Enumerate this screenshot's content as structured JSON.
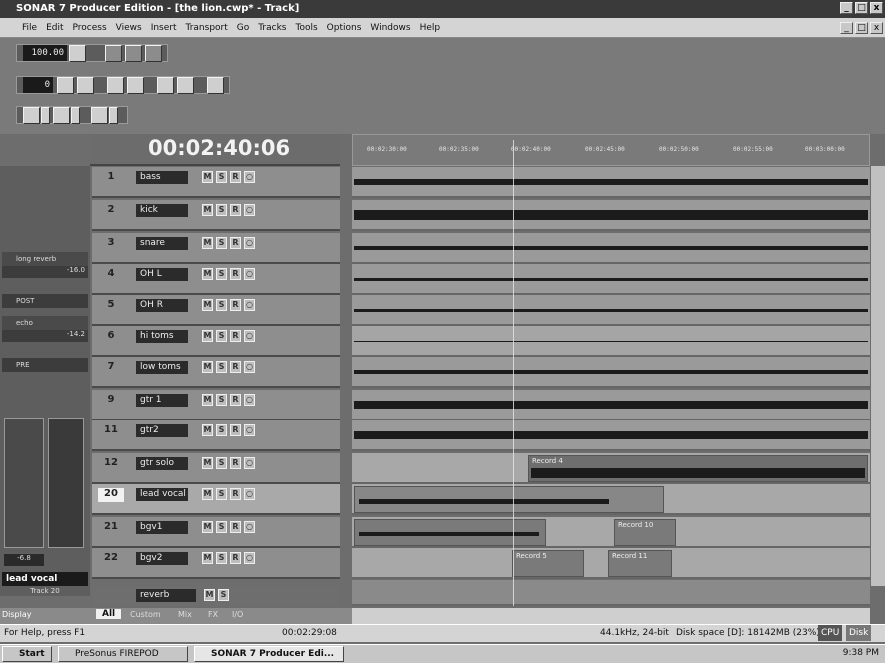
{
  "window": {
    "title": "SONAR 7 Producer Edition - [the lion.cwp* - Track]",
    "controls": [
      "_",
      "□",
      "x"
    ]
  },
  "menu": [
    "File",
    "Edit",
    "Process",
    "Views",
    "Insert",
    "Transport",
    "Go",
    "Tracks",
    "Tools",
    "Options",
    "Windows",
    "Help"
  ],
  "toolbar": {
    "tempo": "100.00",
    "meter_field": "0"
  },
  "transport": {
    "clock": "00:02:40:06"
  },
  "ruler": {
    "ticks": [
      "00:02:30:00",
      "00:02:35:00",
      "00:02:40:00",
      "00:02:45:00",
      "00:02:50:00",
      "00:02:55:00",
      "00:03:00:00"
    ]
  },
  "tracks": [
    {
      "num": "1",
      "name": "bass"
    },
    {
      "num": "2",
      "name": "kick"
    },
    {
      "num": "3",
      "name": "snare"
    },
    {
      "num": "4",
      "name": "OH L"
    },
    {
      "num": "5",
      "name": "OH R"
    },
    {
      "num": "6",
      "name": "hi toms"
    },
    {
      "num": "7",
      "name": "low toms"
    },
    {
      "num": "9",
      "name": "gtr 1"
    },
    {
      "num": "11",
      "name": "gtr2"
    },
    {
      "num": "12",
      "name": "gtr solo"
    },
    {
      "num": "20",
      "name": "lead vocal"
    },
    {
      "num": "21",
      "name": "bgv1"
    },
    {
      "num": "22",
      "name": "bgv2"
    }
  ],
  "clips": {
    "record4": "Record 4",
    "record10": "Record 10",
    "record5": "Record 5",
    "record11": "Record 11"
  },
  "bus": {
    "name": "reverb"
  },
  "inspector": {
    "send1": "long reverb",
    "send1_val": "-16.0",
    "send2": "echo",
    "send2_val": "-14.2",
    "post": "POST",
    "pre": "PRE",
    "vol": "-6.8",
    "track_name": "lead vocal",
    "track_num": "Track 20",
    "display": "Display"
  },
  "tabs": [
    "All",
    "Custom",
    "Mix",
    "FX",
    "I/O"
  ],
  "status": {
    "help": "For Help, press F1",
    "time": "00:02:29:08",
    "format": "44.1kHz, 24-bit",
    "disk": "Disk space [D]: 18142MB (23%)",
    "cpu": "CPU",
    "disk_label": "Disk"
  },
  "taskbar": {
    "start": "Start",
    "task1": "PreSonus FIREPOD",
    "task2": "SONAR 7 Producer Edi...",
    "clock": "9:38 PM"
  }
}
